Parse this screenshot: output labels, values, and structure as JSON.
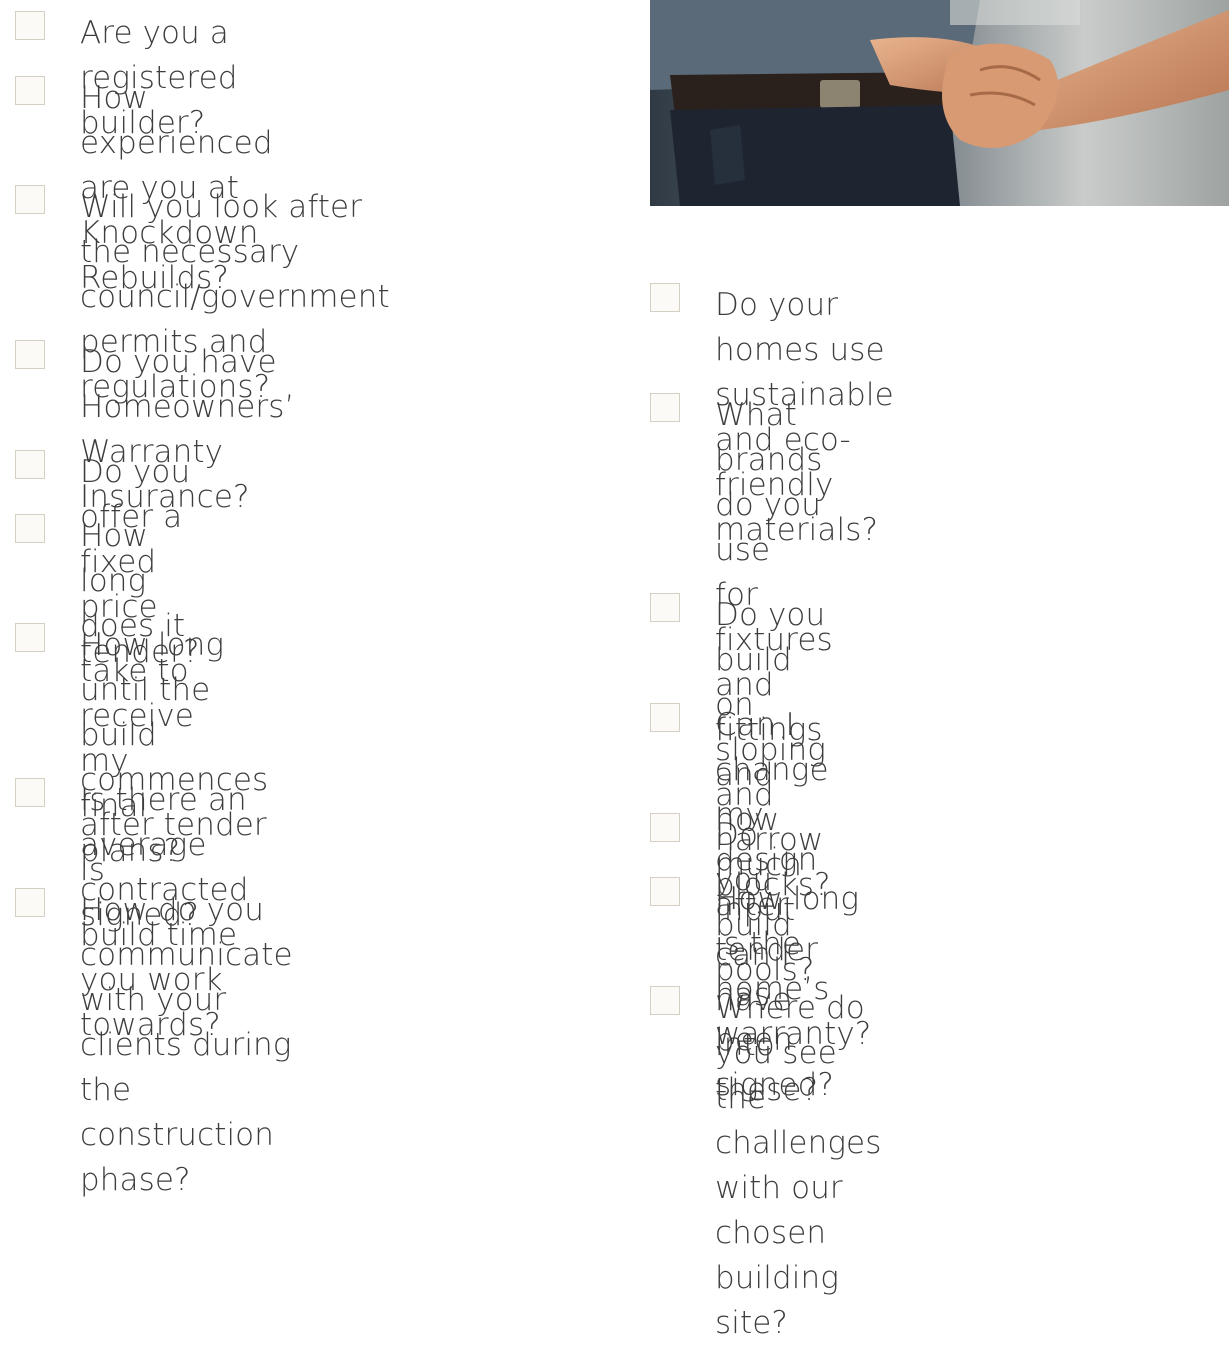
{
  "left_questions": [
    {
      "text": "Are you a registered builder?"
    },
    {
      "text": "How experienced are you at\nKnockdown Rebuilds?"
    },
    {
      "text": "Will you look after the necessary\ncouncil/government permits and\nregulations?"
    },
    {
      "text": "Do you have Homeowners’\nWarranty Insurance?"
    },
    {
      "text": "Do you offer a fixed price tender?"
    },
    {
      "text": "How long does it take to receive\nmy final plans?"
    },
    {
      "text": "How long until the build\ncommences after tender is\nsigned?"
    },
    {
      "text": "Is there an average contracted\nbuild time you work towards?"
    },
    {
      "text": "How do you communicate\nwith your clients during the\nconstruction phase?"
    }
  ],
  "right_questions": [
    {
      "text": "Do your homes use sustainable\nand eco-friendly materials?"
    },
    {
      "text": "What brands do you use\nfor fixtures and fittings and\nhow much input can I have\ninto these?"
    },
    {
      "text": "Do you build on sloping and\nnarrow blocks?"
    },
    {
      "text": "Can I change my design after\ntender has been signed?"
    },
    {
      "text": "Do you build pools?"
    },
    {
      "text": "How long is the home’s\nwarranty?"
    },
    {
      "text": "Where do you see the challenges\nwith our chosen building site?"
    }
  ],
  "photo": {
    "icon": "handshake-photo"
  }
}
